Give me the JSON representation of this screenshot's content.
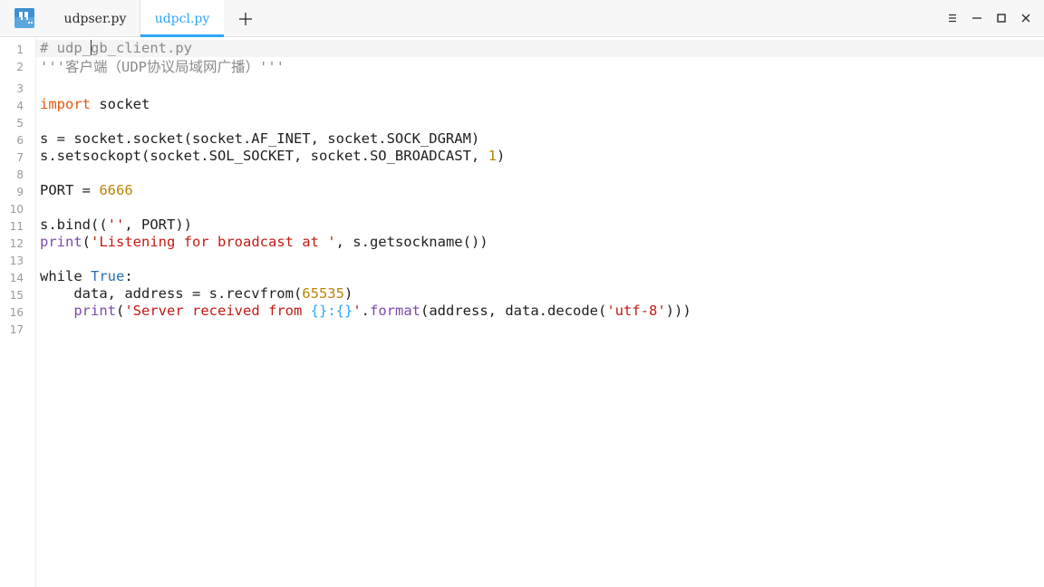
{
  "tabs": [
    {
      "label": "udpser.py",
      "active": false
    },
    {
      "label": "udpcl.py",
      "active": true
    }
  ],
  "icons": {
    "app": "editor-app-icon",
    "new_tab": "plus-icon",
    "menu": "hamburger-menu-icon",
    "minimize": "minimize-icon",
    "maximize": "maximize-icon",
    "close": "close-icon"
  },
  "colors": {
    "accent": "#2ca7f8"
  },
  "line_numbers": [
    "1",
    "2",
    "3",
    "4",
    "5",
    "6",
    "7",
    "8",
    "9",
    "10",
    "11",
    "12",
    "13",
    "14",
    "15",
    "16",
    "17"
  ],
  "code": {
    "l1a": "# udp_",
    "l1b": "gb_client.py",
    "l2": "'''客户端（UDP协议局域网广播）'''",
    "l4_kw": "import",
    "l4_rest": " socket",
    "l6": "s = socket.socket(socket.AF_INET, socket.SOCK_DGRAM)",
    "l7a": "s.setsockopt(socket.SOL_SOCKET, socket.SO_BROADCAST, ",
    "l7_num": "1",
    "l7b": ")",
    "l9a": "PORT = ",
    "l9_num": "6666",
    "l11a": "s.bind((",
    "l11_str": "''",
    "l11b": ", PORT))",
    "l12_fn": "print",
    "l12a": "(",
    "l12_str": "'Listening for broadcast at '",
    "l12b": ", s.getsockname())",
    "l14_kw": "while",
    "l14a": " ",
    "l14_bool": "True",
    "l14b": ":",
    "l15a": "    data, address = s.recvfrom(",
    "l15_num": "65535",
    "l15b": ")",
    "l16_indent": "    ",
    "l16_fn": "print",
    "l16a": "(",
    "l16_str1": "'Server received from ",
    "l16_fmt": "{}:{}",
    "l16_str2": "'",
    "l16b": ".",
    "l16_fn2": "format",
    "l16c": "(address, data.decode(",
    "l16_str3": "'utf-8'",
    "l16d": ")))"
  }
}
